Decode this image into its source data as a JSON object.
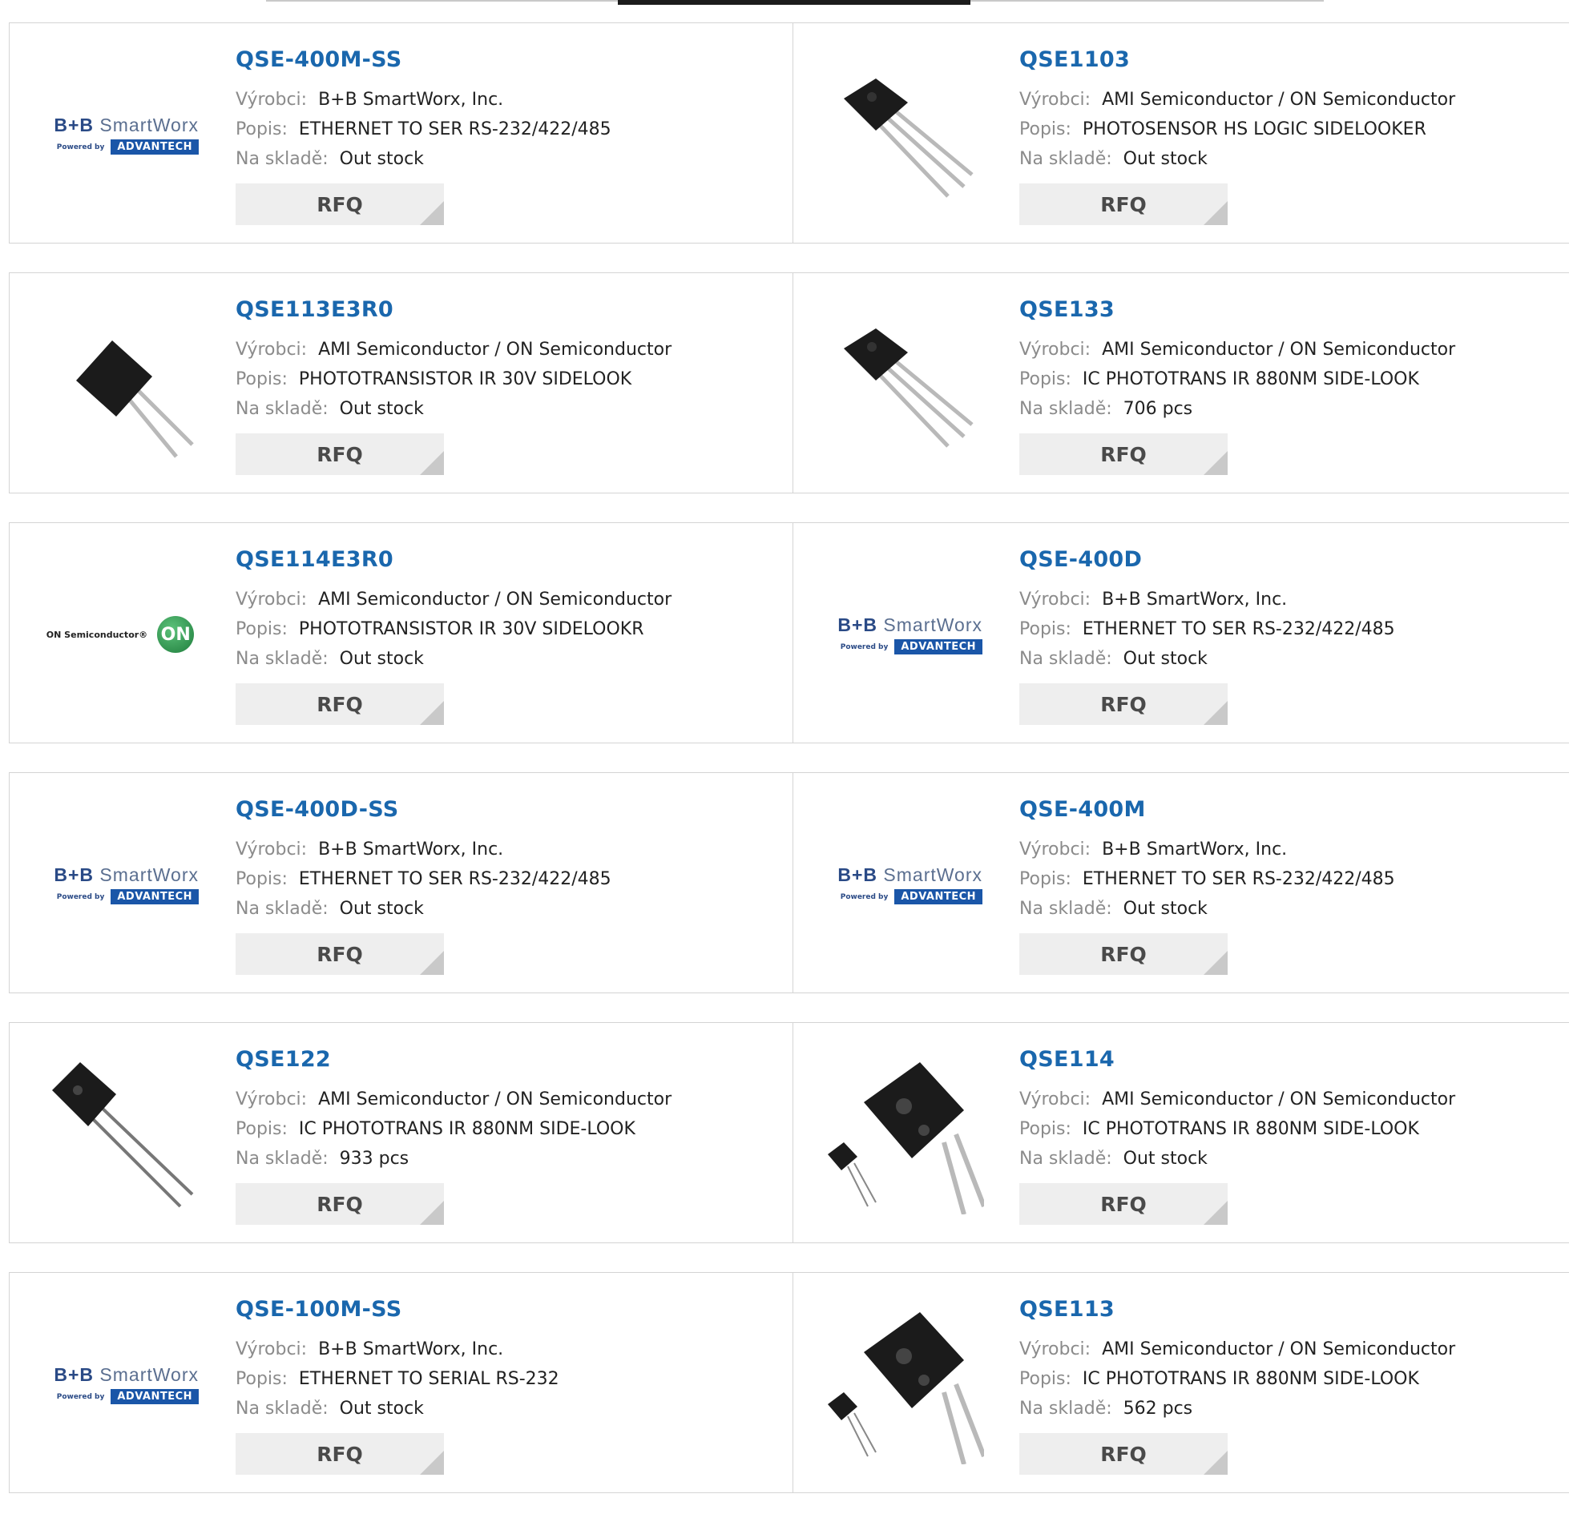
{
  "labels": {
    "manufacturer": "Výrobci:",
    "description": "Popis:",
    "stock": "Na skladě:",
    "rfq": "RFQ"
  },
  "products": [
    {
      "part": "QSE-400M-SS",
      "manufacturer": "B+B SmartWorx, Inc.",
      "description": "ETHERNET TO SER RS-232/422/485",
      "stock": "Out stock",
      "image": "bb-smartworx-logo"
    },
    {
      "part": "QSE1103",
      "manufacturer": "AMI Semiconductor / ON Semiconductor",
      "description": "PHOTOSENSOR HS LOGIC SIDELOOKER",
      "stock": "Out stock",
      "image": "phototransistor-3pin"
    },
    {
      "part": "QSE113E3R0",
      "manufacturer": "AMI Semiconductor / ON Semiconductor",
      "description": "PHOTOTRANSISTOR IR 30V SIDELOOK",
      "stock": "Out stock",
      "image": "phototransistor-2pin"
    },
    {
      "part": "QSE133",
      "manufacturer": "AMI Semiconductor / ON Semiconductor",
      "description": "IC PHOTOTRANS IR 880NM SIDE-LOOK",
      "stock": "706 pcs",
      "image": "phototransistor-3pin"
    },
    {
      "part": "QSE114E3R0",
      "manufacturer": "AMI Semiconductor / ON Semiconductor",
      "description": "PHOTOTRANSISTOR IR 30V SIDELOOKR",
      "stock": "Out stock",
      "image": "on-semiconductor-logo"
    },
    {
      "part": "QSE-400D",
      "manufacturer": "B+B SmartWorx, Inc.",
      "description": "ETHERNET TO SER RS-232/422/485",
      "stock": "Out stock",
      "image": "bb-smartworx-logo"
    },
    {
      "part": "QSE-400D-SS",
      "manufacturer": "B+B SmartWorx, Inc.",
      "description": "ETHERNET TO SER RS-232/422/485",
      "stock": "Out stock",
      "image": "bb-smartworx-logo"
    },
    {
      "part": "QSE-400M",
      "manufacturer": "B+B SmartWorx, Inc.",
      "description": "ETHERNET TO SER RS-232/422/485",
      "stock": "Out stock",
      "image": "bb-smartworx-logo"
    },
    {
      "part": "QSE122",
      "manufacturer": "AMI Semiconductor / ON Semiconductor",
      "description": "IC PHOTOTRANS IR 880NM SIDE-LOOK",
      "stock": "933 pcs",
      "image": "phototransistor-2pin-long"
    },
    {
      "part": "QSE114",
      "manufacturer": "AMI Semiconductor / ON Semiconductor",
      "description": "IC PHOTOTRANS IR 880NM SIDE-LOOK",
      "stock": "Out stock",
      "image": "phototransistor-pair"
    },
    {
      "part": "QSE-100M-SS",
      "manufacturer": "B+B SmartWorx, Inc.",
      "description": "ETHERNET TO SERIAL RS-232",
      "stock": "Out stock",
      "image": "bb-smartworx-logo"
    },
    {
      "part": "QSE113",
      "manufacturer": "AMI Semiconductor / ON Semiconductor",
      "description": "IC PHOTOTRANS IR 880NM SIDE-LOOK",
      "stock": "562 pcs",
      "image": "phototransistor-pair"
    }
  ],
  "logos": {
    "bb_top_a": "B+B ",
    "bb_top_b": "SmartWorx",
    "bb_powered": "Powered by",
    "bb_advantech": "ADVANTECH",
    "on_text": "ON Semiconductor®",
    "on_mark": "ON"
  }
}
